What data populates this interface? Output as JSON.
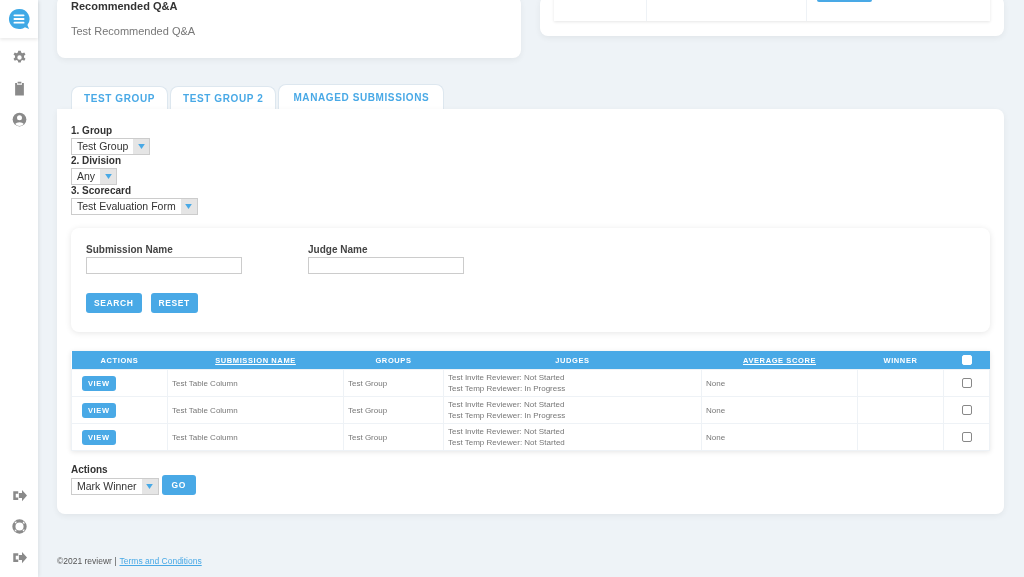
{
  "recommended_card": {
    "heading": "Recommended Q&A",
    "item": "Test Recommended Q&A"
  },
  "tabs": [
    {
      "label": "TEST GROUP",
      "selected": false
    },
    {
      "label": "TEST GROUP 2",
      "selected": false
    },
    {
      "label": "MANAGED SUBMISSIONS",
      "selected": true
    }
  ],
  "filters": [
    {
      "label": "1. Group",
      "value": "Test Group"
    },
    {
      "label": "2. Division",
      "value": "Any"
    },
    {
      "label": "3. Scorecard",
      "value": "Test Evaluation Form"
    }
  ],
  "search_form": {
    "fields": [
      {
        "label": "Submission Name"
      },
      {
        "label": "Judge Name"
      }
    ],
    "buttons": [
      "SEARCH",
      "RESET"
    ]
  },
  "table": {
    "columns": [
      {
        "label": "ACTIONS",
        "sortable": false
      },
      {
        "label": "SUBMISSION NAME",
        "sortable": true
      },
      {
        "label": "GROUPS",
        "sortable": false
      },
      {
        "label": "JUDGES",
        "sortable": false
      },
      {
        "label": "AVERAGE SCORE",
        "sortable": true
      },
      {
        "label": "WINNER",
        "sortable": false
      }
    ],
    "select_all_checked": false,
    "rows": [
      {
        "action": "VIEW",
        "submission": "Test Table Column",
        "group": "Test Group",
        "judges": [
          "Test Invite Reviewer: Not Started",
          "Test Temp Reviewer: In Progress"
        ],
        "average": "None",
        "checked": false
      },
      {
        "action": "VIEW",
        "submission": "Test Table Column",
        "group": "Test Group",
        "judges": [
          "Test Invite Reviewer: Not Started",
          "Test Temp Reviewer: In Progress"
        ],
        "average": "None",
        "checked": false
      },
      {
        "action": "VIEW",
        "submission": "Test Table Column",
        "group": "Test Group",
        "judges": [
          "Test Invite Reviewer: Not Started",
          "Test Temp Reviewer: Not Started"
        ],
        "average": "None",
        "checked": false
      }
    ]
  },
  "bulk_actions": {
    "label": "Actions",
    "value": "Mark Winner",
    "button": "GO"
  },
  "footer": {
    "copyright": "©2021 reviewr |",
    "link": "Terms and Conditions"
  }
}
